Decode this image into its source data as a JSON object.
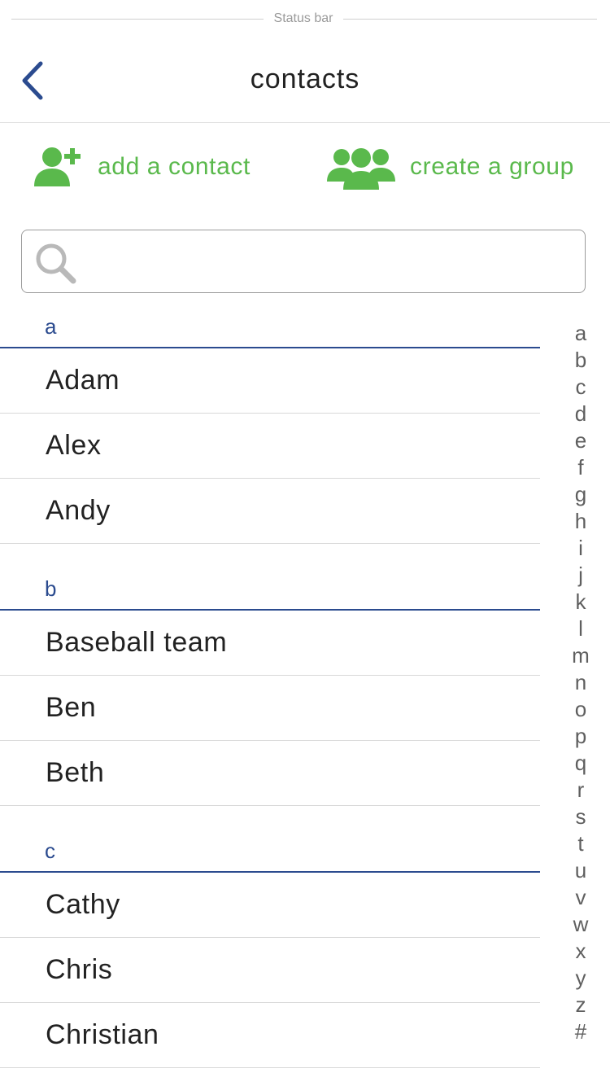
{
  "status_bar": {
    "label": "Status bar"
  },
  "nav": {
    "title": "contacts",
    "back_icon": "chevron-left-icon"
  },
  "actions": {
    "add_contact": {
      "label": "add a contact",
      "icon": "add-person-icon"
    },
    "create_group": {
      "label": "create a group",
      "icon": "group-icon"
    }
  },
  "search": {
    "placeholder": "",
    "value": ""
  },
  "sections": [
    {
      "letter": "a",
      "contacts": [
        "Adam",
        "Alex",
        "Andy"
      ]
    },
    {
      "letter": "b",
      "contacts": [
        "Baseball team",
        "Ben",
        "Beth"
      ]
    },
    {
      "letter": "c",
      "contacts": [
        "Cathy",
        "Chris",
        "Christian"
      ]
    }
  ],
  "index": [
    "a",
    "b",
    "c",
    "d",
    "e",
    "f",
    "g",
    "h",
    "i",
    "j",
    "k",
    "l",
    "m",
    "n",
    "o",
    "p",
    "q",
    "r",
    "s",
    "t",
    "u",
    "v",
    "w",
    "x",
    "y",
    "z",
    "#"
  ],
  "colors": {
    "accent_green": "#5ab94c",
    "accent_blue": "#2b4b8f",
    "text": "#222222"
  }
}
